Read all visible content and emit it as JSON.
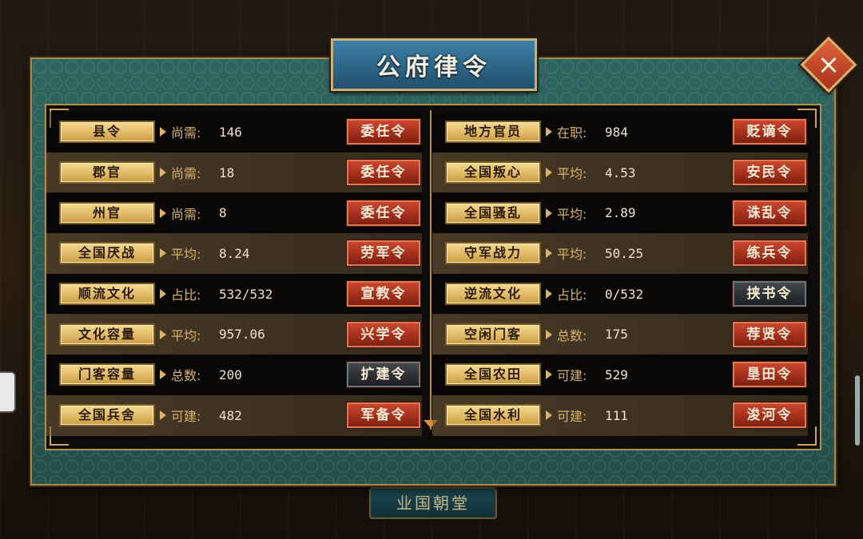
{
  "title": "公府律令",
  "close_label": "×",
  "background_tab": "业国朝堂",
  "left_rows": [
    {
      "label": "县令",
      "metric": "尚需:",
      "value": "146",
      "button": "委任令",
      "button_style": "red"
    },
    {
      "label": "郡官",
      "metric": "尚需:",
      "value": "18",
      "button": "委任令",
      "button_style": "red"
    },
    {
      "label": "州官",
      "metric": "尚需:",
      "value": "8",
      "button": "委任令",
      "button_style": "red"
    },
    {
      "label": "全国厌战",
      "metric": "平均:",
      "value": "8.24",
      "button": "劳军令",
      "button_style": "red"
    },
    {
      "label": "顺流文化",
      "metric": "占比:",
      "value": "532/532",
      "button": "宣教令",
      "button_style": "red"
    },
    {
      "label": "文化容量",
      "metric": "平均:",
      "value": "957.06",
      "button": "兴学令",
      "button_style": "red"
    },
    {
      "label": "门客容量",
      "metric": "总数:",
      "value": "200",
      "button": "扩建令",
      "button_style": "gray"
    },
    {
      "label": "全国兵舍",
      "metric": "可建:",
      "value": "482",
      "button": "军备令",
      "button_style": "red"
    }
  ],
  "right_rows": [
    {
      "label": "地方官员",
      "metric": "在职:",
      "value": "984",
      "button": "贬谪令",
      "button_style": "red"
    },
    {
      "label": "全国叛心",
      "metric": "平均:",
      "value": "4.53",
      "button": "安民令",
      "button_style": "red"
    },
    {
      "label": "全国骚乱",
      "metric": "平均:",
      "value": "2.89",
      "button": "诛乱令",
      "button_style": "red"
    },
    {
      "label": "守军战力",
      "metric": "平均:",
      "value": "50.25",
      "button": "练兵令",
      "button_style": "red"
    },
    {
      "label": "逆流文化",
      "metric": "占比:",
      "value": "0/532",
      "button": "挟书令",
      "button_style": "gray"
    },
    {
      "label": "空闲门客",
      "metric": "总数:",
      "value": "175",
      "button": "荐贤令",
      "button_style": "red"
    },
    {
      "label": "全国农田",
      "metric": "可建:",
      "value": "529",
      "button": "垦田令",
      "button_style": "red"
    },
    {
      "label": "全国水利",
      "metric": "可建:",
      "value": "111",
      "button": "浚河令",
      "button_style": "red"
    }
  ]
}
